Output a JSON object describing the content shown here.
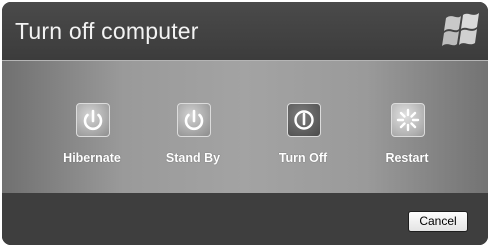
{
  "dialog": {
    "title": "Turn off computer",
    "logo_icon": "windows-flag-icon"
  },
  "options": [
    {
      "label": "Hibernate",
      "icon": "power-icon"
    },
    {
      "label": "Stand By",
      "icon": "power-icon"
    },
    {
      "label": "Turn Off",
      "icon": "power-icon"
    },
    {
      "label": "Restart",
      "icon": "restart-icon"
    }
  ],
  "footer": {
    "cancel_label": "Cancel"
  }
}
